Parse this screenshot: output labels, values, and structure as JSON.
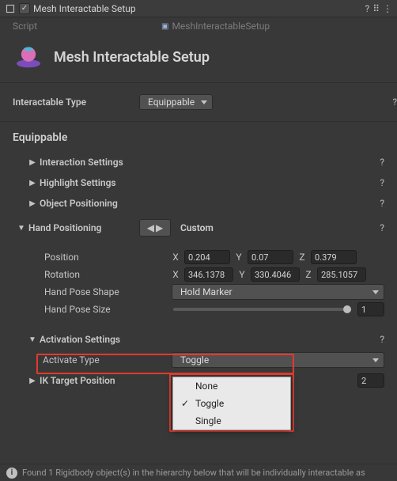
{
  "topbar": {
    "checked": true,
    "title": "Mesh Interactable Setup",
    "help_icon": "?",
    "presets_icon": "⠿",
    "menu_icon": "⋮"
  },
  "script": {
    "label": "Script",
    "value": "MeshInteractableSetup"
  },
  "header": {
    "title": "Mesh Interactable Setup"
  },
  "type_row": {
    "label": "Interactable Type",
    "value": "Equippable"
  },
  "equippable": {
    "title": "Equippable",
    "interaction_settings": "Interaction Settings",
    "highlight_settings": "Highlight Settings",
    "object_positioning": "Object Positioning",
    "hand_positioning": {
      "label": "Hand Positioning",
      "mode": "Custom"
    },
    "vectors": {
      "position": {
        "label": "Position",
        "x": "0.204",
        "y": "0.07",
        "z": "0.379"
      },
      "rotation": {
        "label": "Rotation",
        "x": "346.1378",
        "y": "330.4046",
        "z": "285.1057"
      }
    },
    "hand_pose_shape": {
      "label": "Hand Pose Shape",
      "value": "Hold Marker"
    },
    "hand_pose_size": {
      "label": "Hand Pose Size",
      "value": "1"
    },
    "activation": {
      "label": "Activation Settings",
      "activate_type_label": "Activate Type",
      "activate_type_value": "Toggle",
      "options": [
        "None",
        "Toggle",
        "Single"
      ]
    },
    "ik": {
      "label": "IK Target Position",
      "value": "2"
    }
  },
  "axes": {
    "x": "X",
    "y": "Y",
    "z": "Z"
  },
  "footer": {
    "text": "Found 1 Rigidbody object(s) in the hierarchy below that will be individually interactable as"
  }
}
